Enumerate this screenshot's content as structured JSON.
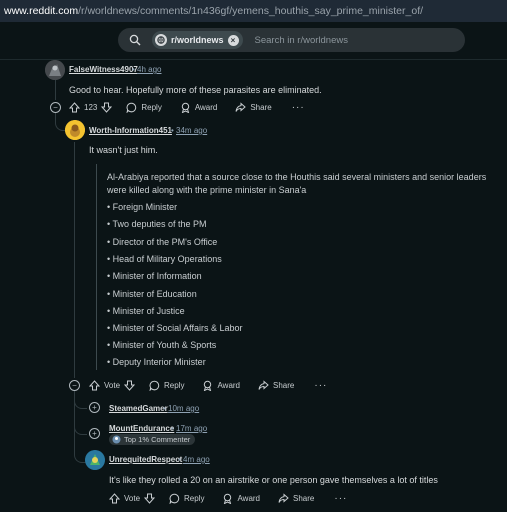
{
  "browser": {
    "url_host": "www.reddit.com",
    "url_path": "/r/worldnews/comments/1n436gf/yemens_houthis_say_prime_minister_of/"
  },
  "search": {
    "subreddit": "r/worldnews",
    "placeholder": "Search in r/worldnews"
  },
  "comments": [
    {
      "user": "FalseWitness4907",
      "time": "4h ago",
      "body": "Good to hear. Hopefully more of these parasites are eliminated.",
      "votes": "123",
      "actions": [
        "Reply",
        "Award",
        "Share"
      ]
    },
    {
      "user": "Worth-Information451",
      "time": "34m ago",
      "body": "It wasn't just him.",
      "quote_lines": [
        "Al-Arabiya reported that a source close to the Houthis said several ministers and senior leaders",
        "were killed along with the prime minister in Sana'a"
      ],
      "bullets": [
        "Foreign Minister",
        "Two deputies of the PM",
        "Director of the PM's Office",
        "Head of Military Operations",
        "Minister of Information",
        "Minister of Education",
        "Minister of Justice",
        "Minister of Social Affairs & Labor",
        "Minister of Youth & Sports",
        "Deputy Interior Minister"
      ],
      "votes": "Vote",
      "actions": [
        "Reply",
        "Award",
        "Share"
      ]
    },
    {
      "user": "SteamedGamer",
      "time": "10m ago",
      "collapsed": true
    },
    {
      "user": "MountEndurance",
      "time": "17m ago",
      "flair": "Top 1% Commenter",
      "collapsed": true
    },
    {
      "user": "UnrequitedRespect",
      "time": "4m ago",
      "body": "It's like they rolled a 20 on an airstrike or one person gave themselves a lot of titles",
      "votes": "Vote",
      "actions": [
        "Reply",
        "Award",
        "Share"
      ]
    }
  ],
  "icons": [
    "search-icon",
    "subreddit-icon",
    "clear-icon",
    "upvote-icon",
    "downvote-icon",
    "reply-icon",
    "award-icon",
    "share-icon",
    "more-icon",
    "collapse-icon",
    "expand-icon"
  ],
  "colors": {
    "background": "#0b1416",
    "text": "#d7dadc",
    "meta": "#8fa2b3",
    "search_bg": "#2a3236"
  }
}
